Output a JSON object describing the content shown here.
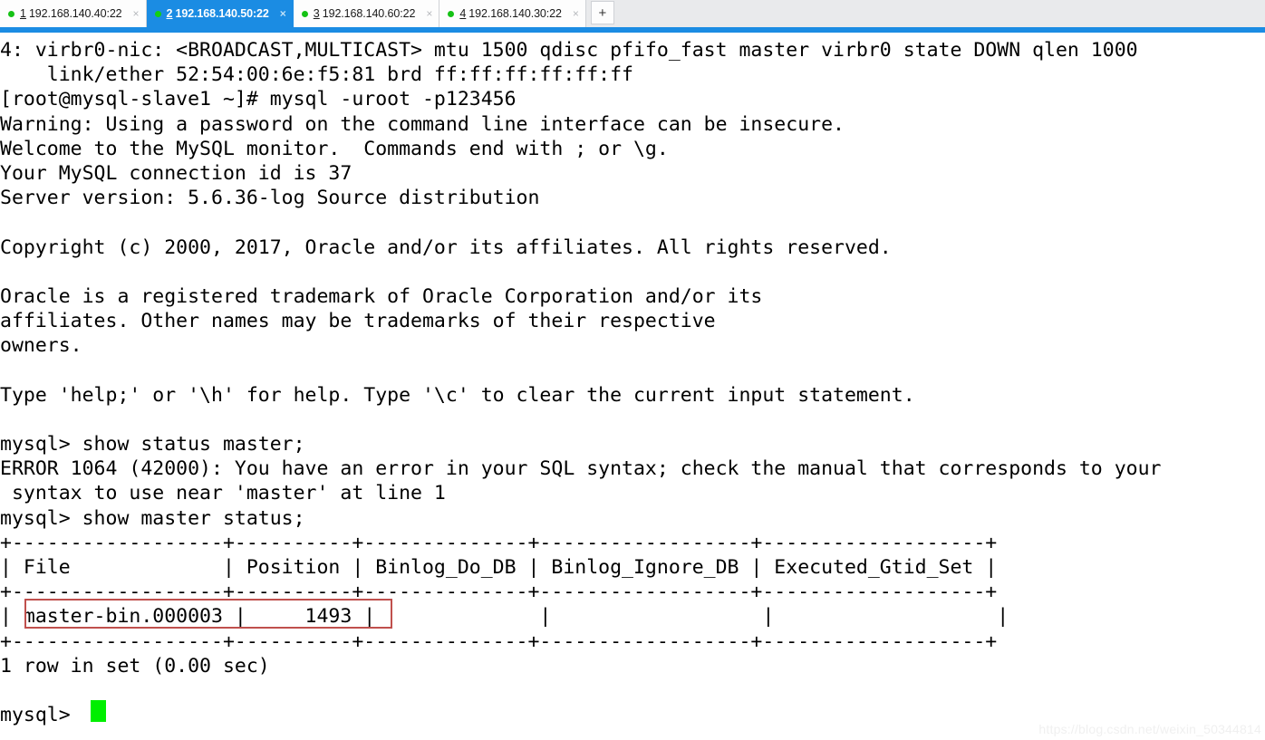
{
  "tabbar": {
    "tabs": [
      {
        "index": "1",
        "title": "192.168.140.40:22",
        "status": "connected",
        "active": false,
        "close": "×"
      },
      {
        "index": "2",
        "title": "192.168.140.50:22",
        "status": "connected",
        "active": true,
        "close": "×"
      },
      {
        "index": "3",
        "title": "192.168.140.60:22",
        "status": "connected",
        "active": false,
        "close": "×"
      },
      {
        "index": "4",
        "title": "192.168.140.30:22",
        "status": "connected",
        "active": false,
        "close": "×"
      }
    ],
    "new_tab_label": "+"
  },
  "colors": {
    "active_tab": "#1b8ce3",
    "status_dot": "#15c215",
    "cursor": "#00ef00",
    "annotation_box": "#c0504d",
    "terminal_bg": "#ffffff",
    "terminal_fg": "#000000"
  },
  "terminal": {
    "lines": [
      "4: virbr0-nic: <BROADCAST,MULTICAST> mtu 1500 qdisc pfifo_fast master virbr0 state DOWN qlen 1000",
      "    link/ether 52:54:00:6e:f5:81 brd ff:ff:ff:ff:ff:ff",
      "[root@mysql-slave1 ~]# mysql -uroot -p123456",
      "Warning: Using a password on the command line interface can be insecure.",
      "Welcome to the MySQL monitor.  Commands end with ; or \\g.",
      "Your MySQL connection id is 37",
      "Server version: 5.6.36-log Source distribution",
      "",
      "Copyright (c) 2000, 2017, Oracle and/or its affiliates. All rights reserved.",
      "",
      "Oracle is a registered trademark of Oracle Corporation and/or its",
      "affiliates. Other names may be trademarks of their respective",
      "owners.",
      "",
      "Type 'help;' or '\\h' for help. Type '\\c' to clear the current input statement.",
      "",
      "mysql> show status master;",
      "ERROR 1064 (42000): You have an error in your SQL syntax; check the manual that corresponds to your",
      " syntax to use near 'master' at line 1",
      "mysql> show master status;",
      "+------------------+----------+--------------+------------------+-------------------+",
      "| File             | Position | Binlog_Do_DB | Binlog_Ignore_DB | Executed_Gtid_Set |",
      "+------------------+----------+--------------+------------------+-------------------+",
      "| master-bin.000003 |     1493 |              |                  |                   |",
      "+------------------+----------+--------------+------------------+-------------------+",
      "1 row in set (0.00 sec)",
      "",
      "mysql> "
    ],
    "prompt": "mysql> ",
    "cursor_glyph": "█",
    "highlighted_value": "master-bin.000003 |      1493"
  },
  "watermark": {
    "text": "https://blog.csdn.net/weixin_50344814"
  }
}
